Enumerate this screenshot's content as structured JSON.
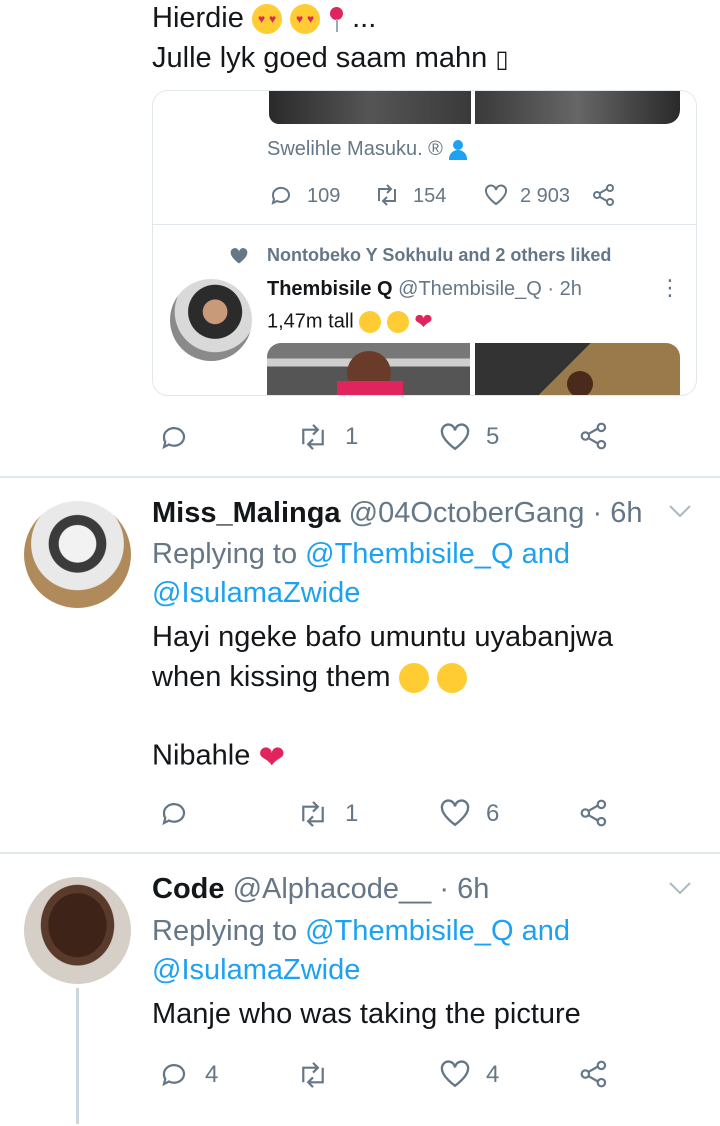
{
  "top_tweet": {
    "line1": "Hierdie",
    "line1_tail": "...",
    "line2": "Julle lyk goed saam mahn",
    "line2_glyph": "▯"
  },
  "quoted_card": {
    "author_line": "Swelihle Masuku. ®",
    "stats": {
      "replies": "109",
      "retweets": "154",
      "likes": "2 903"
    },
    "liked_by": "Nontobeko Y Sokhulu and 2 others liked",
    "inner": {
      "name": "Thembisile Q",
      "handle": "@Thembisile_Q",
      "dot": "·",
      "time": "2h",
      "text": "1,47m tall",
      "more": "⋮"
    }
  },
  "top_actions": {
    "retweets": "1",
    "likes": "5"
  },
  "tweets": [
    {
      "name": "Miss_Malinga",
      "handle": "@04OctoberGang",
      "time": "· 6h",
      "replying_prefix": "Replying to",
      "replying_user1": "@Thembisile_Q",
      "replying_and": "and",
      "replying_user2": "@IsulamaZwide",
      "text_line1": "Hayi ngeke bafo umuntu uyabanjwa",
      "text_line2": "when kissing them",
      "text_line3": "Nibahle",
      "retweets": "1",
      "likes": "6"
    },
    {
      "name": "Code",
      "handle": "@Alphacode__",
      "time": "· 6h",
      "replying_prefix": "Replying to",
      "replying_user1": "@Thembisile_Q",
      "replying_and": "and",
      "replying_user2": "@IsulamaZwide",
      "text_line1": "Manje who was taking the picture",
      "replies": "4",
      "likes": "4"
    }
  ],
  "colors": {
    "blue": "#1da1f2",
    "gray": "#657786",
    "divider": "#e1e8ed",
    "heart_red": "#e0245e"
  }
}
